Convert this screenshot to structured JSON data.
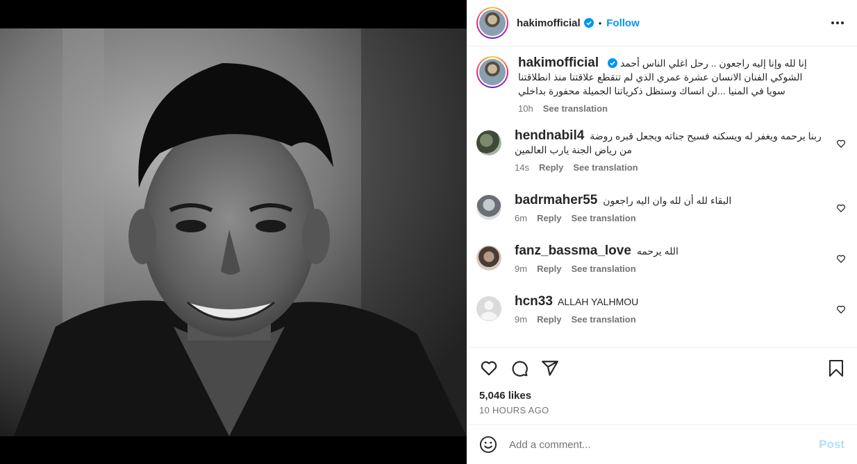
{
  "header": {
    "username": "hakimofficial",
    "follow_label": "Follow",
    "separator": "•"
  },
  "caption": {
    "username": "hakimofficial",
    "text": "إنا لله وإنا إليه راجعون .. رحل اغلي الناس أحمد الشوكي الفنان الانسان عشرة عمري الذي لم تنقطع علاقتنا منذ انطلاقتنا سويا في المنيا ...لن انساك وستظل ذكرياتنا الجميلة محفورة بداخلي",
    "time": "10h",
    "see_translation": "See translation"
  },
  "comments": [
    {
      "username": "hendnabil4",
      "text": "ربنا يرحمه ويغفر له ويسكنه فسيح جناته ويجعل قبره روضة من رياض الجنة يارب العالمين",
      "time": "14s",
      "reply": "Reply",
      "see_translation": "See translation"
    },
    {
      "username": "badrmaher55",
      "text": "البقاء لله أن لله وان اليه راجعون",
      "time": "6m",
      "reply": "Reply",
      "see_translation": "See translation"
    },
    {
      "username": "fanz_bassma_love",
      "text": "الله يرحمه",
      "time": "9m",
      "reply": "Reply",
      "see_translation": "See translation"
    },
    {
      "username": "hcn33",
      "text": "ALLAH YALHMOU",
      "time": "9m",
      "reply": "Reply",
      "see_translation": "See translation"
    }
  ],
  "likes": "5,046 likes",
  "posted_ago": "10 HOURS AGO",
  "add_comment": {
    "placeholder": "Add a comment...",
    "post_label": "Post"
  },
  "colors": {
    "accent": "#0095f6",
    "post_disabled": "#b2dffc",
    "meta": "#737373"
  },
  "icons": {
    "more": "more-icon",
    "verified": "verified-badge-icon",
    "like": "heart-icon",
    "comment": "comment-icon",
    "share": "share-icon",
    "save": "bookmark-icon",
    "emoji": "emoji-icon"
  }
}
